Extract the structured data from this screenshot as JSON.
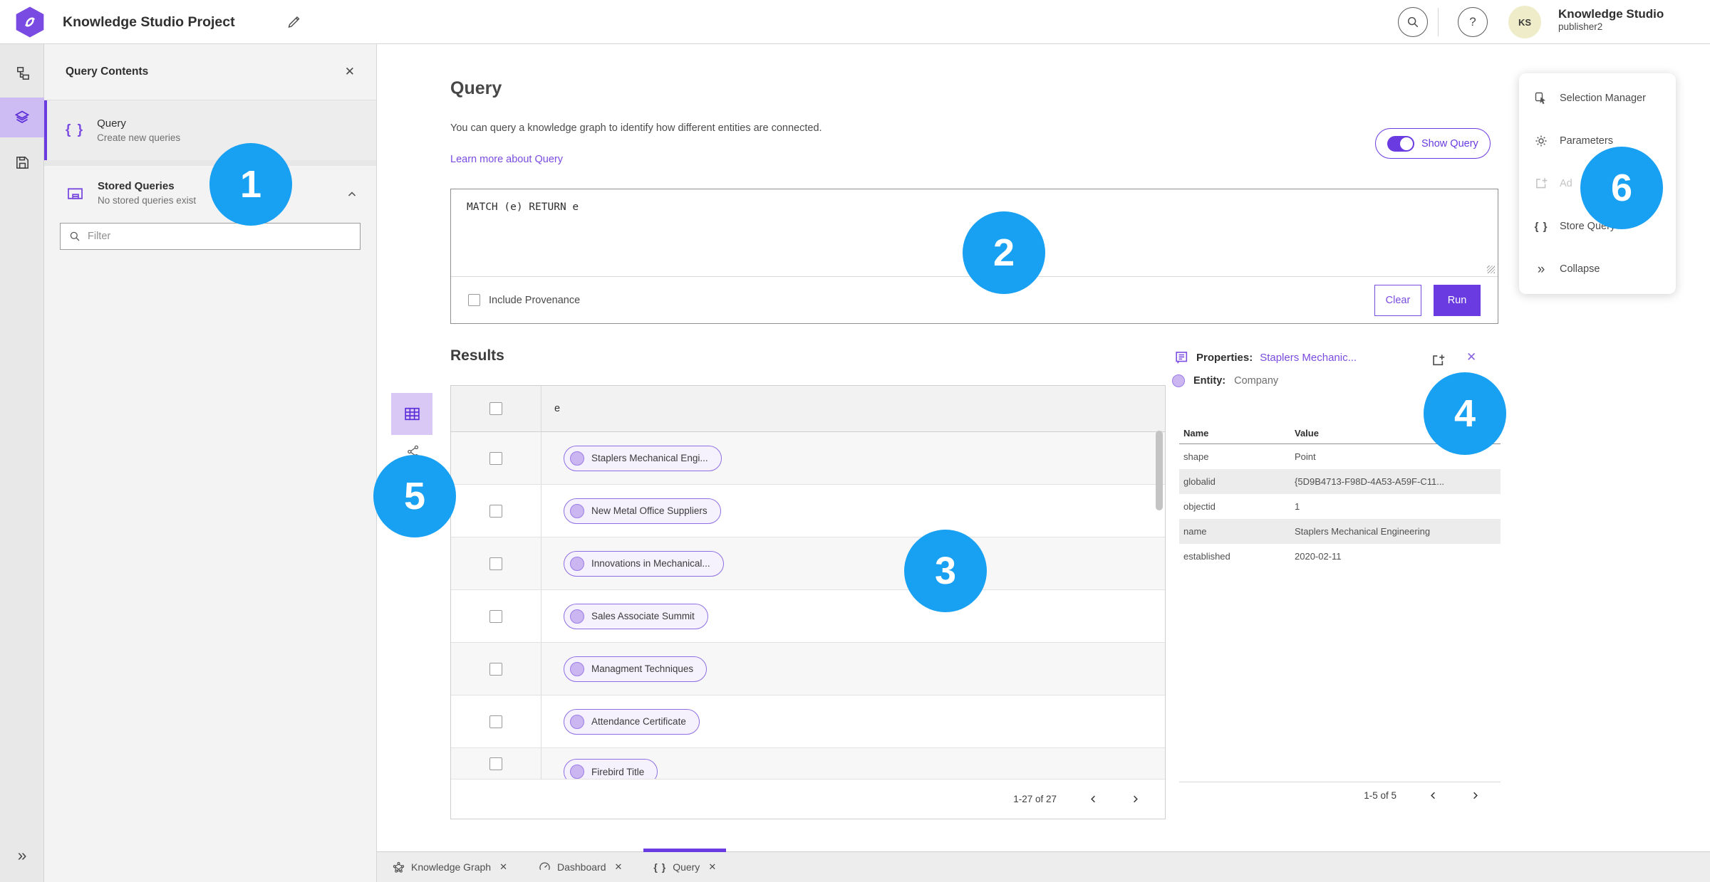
{
  "colors": {
    "accent_purple": "#6a3be0",
    "link_purple": "#7a4be0",
    "light_purple_fill": "#d9c8f6",
    "annotation_blue": "#18a0f2",
    "avatar_bg": "#efecca"
  },
  "topbar": {
    "title": "Knowledge Studio Project",
    "app_name": "Knowledge Studio",
    "user_role": "publisher2",
    "avatar_initials": "KS",
    "help_glyph": "?"
  },
  "contents_panel": {
    "title": "Query Contents",
    "close_glyph": "✕",
    "query_item": {
      "label": "Query",
      "sublabel": "Create new queries"
    },
    "stored_queries": {
      "label": "Stored Queries",
      "sublabel": "No stored queries exist"
    },
    "filter_placeholder": "Filter"
  },
  "query_section": {
    "heading": "Query",
    "description": "You can query a knowledge graph to identify how different entities are connected.",
    "learn_more_label": "Learn more about Query",
    "show_query_label": "Show Query",
    "query_text": "MATCH (e) RETURN e",
    "include_provenance_label": "Include Provenance",
    "clear_label": "Clear",
    "run_label": "Run"
  },
  "results": {
    "heading": "Results",
    "column_header": "e",
    "rows": [
      "Staplers Mechanical Engi...",
      "New Metal Office Suppliers",
      "Innovations in Mechanical...",
      "Sales Associate Summit",
      "Managment Techniques",
      "Attendance Certificate",
      "Firebird Title"
    ],
    "pagination": "1-27 of 27"
  },
  "properties_panel": {
    "title_label": "Properties:",
    "title_value": "Staplers Mechanic...",
    "close_glyph": "✕",
    "entity_label": "Entity:",
    "entity_value": "Company",
    "name_column": "Name",
    "value_column": "Value",
    "rows": [
      {
        "name": "shape",
        "value": "Point"
      },
      {
        "name": "globalid",
        "value": "{5D9B4713-F98D-4A53-A59F-C11..."
      },
      {
        "name": "objectid",
        "value": "1"
      },
      {
        "name": "name",
        "value": "Staplers Mechanical Engineering"
      },
      {
        "name": "established",
        "value": "2020-02-11"
      }
    ],
    "pagination": "1-5 of 5"
  },
  "side_menu": {
    "items": [
      {
        "label": "Selection Manager"
      },
      {
        "label": "Parameters"
      },
      {
        "label": "Ad"
      },
      {
        "label": "Store Query"
      },
      {
        "label": "Collapse"
      }
    ]
  },
  "tabs": [
    {
      "label": "Knowledge Graph"
    },
    {
      "label": "Dashboard"
    },
    {
      "label": "Query"
    }
  ],
  "annotations": [
    "1",
    "2",
    "3",
    "4",
    "5",
    "6"
  ],
  "glyphs": {
    "braces": "{ }",
    "double_chevron": "»"
  }
}
